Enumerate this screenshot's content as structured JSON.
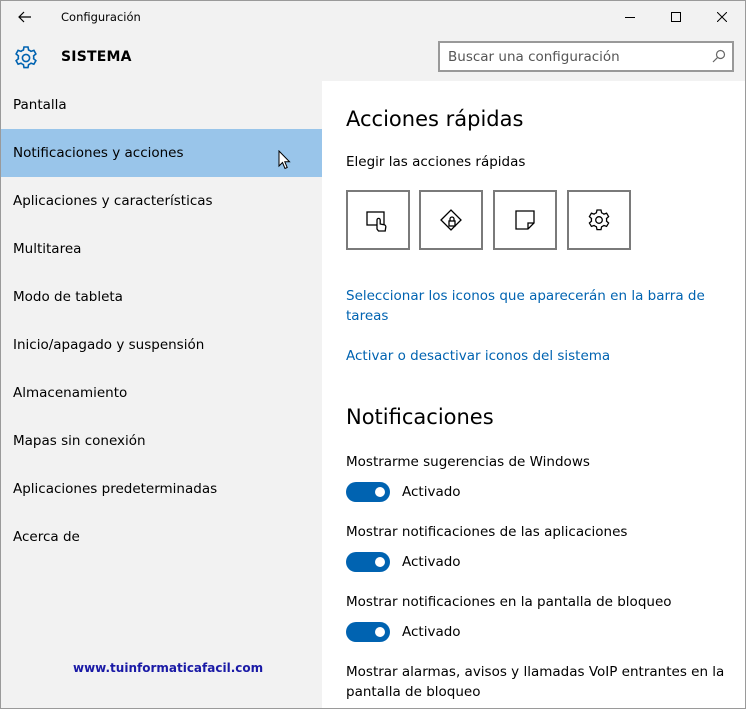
{
  "window": {
    "title": "Configuración"
  },
  "header": {
    "section_title": "SISTEMA",
    "search_placeholder": "Buscar una configuración"
  },
  "sidebar": {
    "items": [
      {
        "label": "Pantalla",
        "selected": false
      },
      {
        "label": "Notificaciones y acciones",
        "selected": true
      },
      {
        "label": "Aplicaciones y características",
        "selected": false
      },
      {
        "label": "Multitarea",
        "selected": false
      },
      {
        "label": "Modo de tableta",
        "selected": false
      },
      {
        "label": "Inicio/apagado y suspensión",
        "selected": false
      },
      {
        "label": "Almacenamiento",
        "selected": false
      },
      {
        "label": "Mapas sin conexión",
        "selected": false
      },
      {
        "label": "Aplicaciones predeterminadas",
        "selected": false
      },
      {
        "label": "Acerca de",
        "selected": false
      }
    ],
    "watermark": "www.tuinformaticafacil.com"
  },
  "main": {
    "quick_actions": {
      "heading": "Acciones rápidas",
      "subheading": "Elegir las acciones rápidas",
      "tiles": [
        {
          "icon": "tablet-mode-icon"
        },
        {
          "icon": "location-icon"
        },
        {
          "icon": "note-icon"
        },
        {
          "icon": "gear-icon"
        }
      ]
    },
    "links": {
      "taskbar_icons": "Seleccionar los iconos que aparecerán en la barra de tareas",
      "system_icons": "Activar o desactivar iconos del sistema"
    },
    "notifications": {
      "heading": "Notificaciones",
      "settings": [
        {
          "label": "Mostrarme sugerencias de Windows",
          "state": "Activado",
          "on": true
        },
        {
          "label": "Mostrar notificaciones de las aplicaciones",
          "state": "Activado",
          "on": true
        },
        {
          "label": "Mostrar notificaciones en la pantalla de bloqueo",
          "state": "Activado",
          "on": true
        }
      ],
      "last_label": "Mostrar alarmas, avisos y llamadas VoIP entrantes en la pantalla de bloqueo"
    }
  },
  "colors": {
    "accent": "#0063b1",
    "selected_nav": "#99c5ea",
    "chrome_bg": "#f2f2f2",
    "watermark": "#1a1aa6"
  }
}
